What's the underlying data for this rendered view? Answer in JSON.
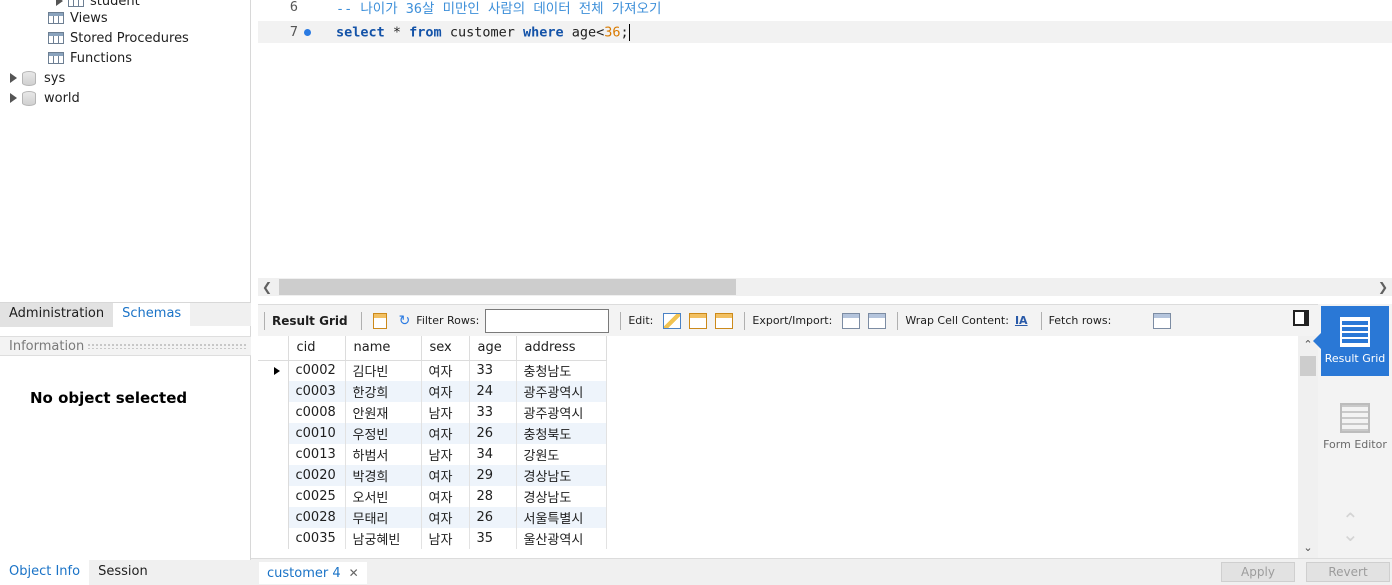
{
  "navigator": {
    "tree": [
      {
        "label": "student",
        "type": "table"
      },
      {
        "label": "Views",
        "type": "folder"
      },
      {
        "label": "Stored Procedures",
        "type": "folder"
      },
      {
        "label": "Functions",
        "type": "folder"
      },
      {
        "label": "sys",
        "type": "schema"
      },
      {
        "label": "world",
        "type": "schema"
      }
    ],
    "tabs": [
      "Administration",
      "Schemas"
    ],
    "info_label": "Information",
    "no_object": "No object selected",
    "bottom_tabs": [
      "Object Info",
      "Session"
    ]
  },
  "editor": {
    "lines": [
      {
        "num": "6",
        "comment": "-- 나이가 36살 미만인 사람의 데이터 전체 가져오기"
      },
      {
        "num": "7",
        "kw1": "select",
        "t1": " * ",
        "kw2": "from",
        "t2": " customer ",
        "kw3": "where",
        "t3": " age<",
        "number": "36",
        "t4": ";"
      }
    ]
  },
  "toolbar": {
    "result_grid": "Result Grid",
    "filter_rows": "Filter Rows:",
    "filter_value": "",
    "edit": "Edit:",
    "export_import": "Export/Import:",
    "wrap_cell": "Wrap Cell Content:",
    "fetch_rows": "Fetch rows:"
  },
  "grid": {
    "columns": [
      "cid",
      "name",
      "sex",
      "age",
      "address"
    ],
    "rows": [
      [
        "c0002",
        "김다빈",
        "여자",
        "33",
        "충청남도"
      ],
      [
        "c0003",
        "한강희",
        "여자",
        "24",
        "광주광역시"
      ],
      [
        "c0008",
        "안원재",
        "남자",
        "33",
        "광주광역시"
      ],
      [
        "c0010",
        "우정빈",
        "여자",
        "26",
        "충청북도"
      ],
      [
        "c0013",
        "하범서",
        "남자",
        "34",
        "강원도"
      ],
      [
        "c0020",
        "박경희",
        "여자",
        "29",
        "경상남도"
      ],
      [
        "c0025",
        "오서빈",
        "여자",
        "28",
        "경상남도"
      ],
      [
        "c0028",
        "무태리",
        "여자",
        "26",
        "서울특별시"
      ],
      [
        "c0035",
        "남궁혜빈",
        "남자",
        "35",
        "울산광역시"
      ]
    ]
  },
  "side_panel": {
    "result_grid": "Result Grid",
    "form_editor": "Form Editor"
  },
  "bottom": {
    "result_tab": "customer 4",
    "apply": "Apply",
    "revert": "Revert"
  },
  "colors": {
    "accent": "#2a78d6",
    "link": "#1a73c7",
    "keyword": "#1453a8",
    "comment": "#3d8fd9",
    "number": "#d97a00"
  }
}
